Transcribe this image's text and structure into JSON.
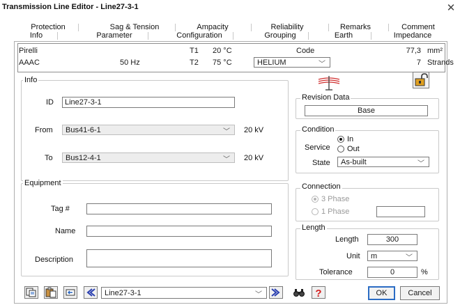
{
  "window": {
    "title": "Transmission Line Editor - Line27-3-1"
  },
  "tabs_top": [
    "Protection",
    "Sag & Tension",
    "Ampacity",
    "Reliability",
    "Remarks",
    "Comment"
  ],
  "tabs_bottom": [
    "Info",
    "Parameter",
    "Configuration",
    "Grouping",
    "Earth",
    "Impedance"
  ],
  "active_tab": "Info",
  "info_strip": {
    "manufacturer": "Pirelli",
    "conductor_type": "AAAC",
    "frequency": "50 Hz",
    "t1_label": "T1",
    "t1_value": "20 °C",
    "t2_label": "T2",
    "t2_value": "75 °C",
    "code_label": "Code",
    "code_value": "HELIUM",
    "area_value": "77,3",
    "area_unit": "mm²",
    "strands_value": "7",
    "strands_unit": "Strands"
  },
  "info_group": {
    "label": "Info",
    "id_label": "ID",
    "id_value": "Line27-3-1",
    "from_label": "From",
    "from_value": "Bus41-6-1",
    "from_kv": "20 kV",
    "to_label": "To",
    "to_value": "Bus12-4-1",
    "to_kv": "20 kV"
  },
  "revision": {
    "label": "Revision Data",
    "value": "Base"
  },
  "condition": {
    "label": "Condition",
    "service_label": "Service",
    "in_label": "In",
    "out_label": "Out",
    "service_selected": "In",
    "state_label": "State",
    "state_value": "As-built"
  },
  "equipment": {
    "label": "Equipment",
    "tag_label": "Tag #",
    "tag_value": "",
    "name_label": "Name",
    "name_value": "",
    "description_label": "Description",
    "description_value": ""
  },
  "connection": {
    "label": "Connection",
    "three_phase": "3 Phase",
    "one_phase": "1 Phase",
    "selected": "3 Phase",
    "phase_value": ""
  },
  "length": {
    "label": "Length",
    "length_label": "Length",
    "length_value": "300",
    "unit_label": "Unit",
    "unit_value": "m",
    "tolerance_label": "Tolerance",
    "tolerance_value": "0",
    "tolerance_unit": "%"
  },
  "footer": {
    "nav_value": "Line27-3-1",
    "ok_label": "OK",
    "cancel_label": "Cancel"
  },
  "colors": {
    "ok_border": "#2b6cc4",
    "help_icon": "#d42020",
    "tower_icon": "#d03030"
  },
  "icons": [
    "copy-icon",
    "paste-icon",
    "undo-icon",
    "prev-icon",
    "next-icon",
    "find-icon",
    "help-icon",
    "tower-icon",
    "padlock-icon",
    "close-icon"
  ]
}
